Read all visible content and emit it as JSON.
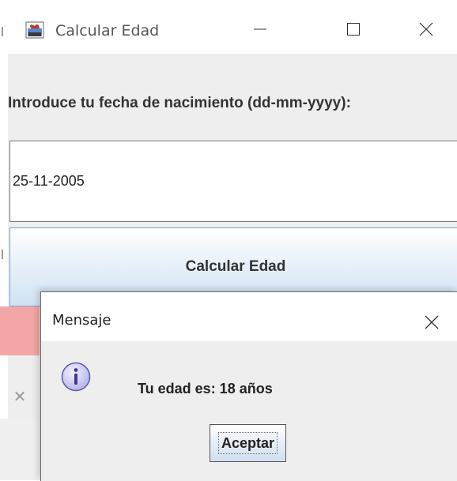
{
  "window": {
    "title": "Calcular Edad",
    "icon": "java-cup-icon"
  },
  "form": {
    "prompt": "Introduce tu fecha de nacimiento (dd-mm-yyyy):",
    "date_value": "25-11-2005",
    "button_label": "Calcular Edad"
  },
  "dialog": {
    "title": "Mensaje",
    "message": "Tu edad es: 18 años",
    "ok_label": "Aceptar",
    "icon": "info-icon"
  },
  "colors": {
    "button_gradient_end": "#d1e2f4",
    "red_panel": "#f3a6a6",
    "info_icon_fill": "#c9c8f2"
  }
}
